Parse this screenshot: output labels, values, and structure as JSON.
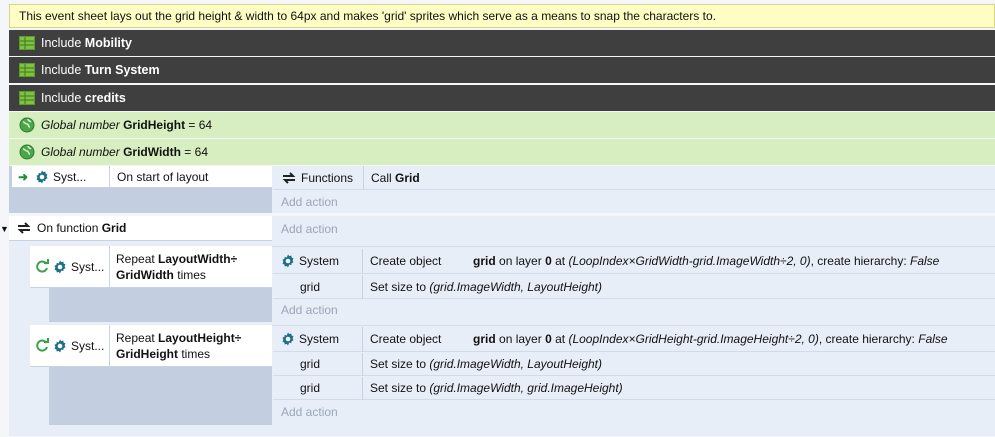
{
  "comment": "This event sheet lays out the grid height & width to 64px and makes 'grid' sprites which serve as a means to snap the characters to.",
  "includes": [
    {
      "prefix": "Include",
      "name": "Mobility"
    },
    {
      "prefix": "Include",
      "name": "Turn System"
    },
    {
      "prefix": "Include",
      "name": "credits"
    }
  ],
  "globals": [
    {
      "prefix": "Global number",
      "name": "GridHeight",
      "suffix": "= 64"
    },
    {
      "prefix": "Global number",
      "name": "GridWidth",
      "suffix": "= 64"
    }
  ],
  "event_start": {
    "object": "Syst...",
    "condition": "On start of layout",
    "action_object": "Functions",
    "action_prefix": "Call",
    "action_name": "Grid",
    "add_action": "Add action"
  },
  "function_event": {
    "prefix": "On function",
    "name": "Grid",
    "add_action": "Add action"
  },
  "sub1": {
    "object": "Syst...",
    "cond_prefix": "Repeat",
    "cond_bold1": "LayoutWidth÷",
    "cond_bold2": "GridWidth",
    "cond_suffix": "times",
    "actions": [
      {
        "object": "System",
        "label": "Create object",
        "obj": "grid",
        "mid": "on layer",
        "layer": "0",
        "at": "at",
        "expr": "(LoopIndex×GridWidth-grid.ImageWidth÷2, 0)",
        "tail": ", create hierarchy:",
        "val": "False"
      },
      {
        "object": "grid",
        "label": "Set size to",
        "expr": "(grid.ImageWidth, LayoutHeight)"
      }
    ],
    "add_action": "Add action"
  },
  "sub2": {
    "object": "Syst...",
    "cond_prefix": "Repeat",
    "cond_bold1": "LayoutHeight÷",
    "cond_bold2": "GridHeight",
    "cond_suffix": "times",
    "actions": [
      {
        "object": "System",
        "label": "Create object",
        "obj": "grid",
        "mid": "on layer",
        "layer": "0",
        "at": "at",
        "expr": "(LoopIndex×GridHeight-grid.ImageHeight÷2, 0)",
        "tail": ", create hierarchy:",
        "val": "False"
      },
      {
        "object": "grid",
        "label": "Set size to",
        "expr": "(grid.ImageWidth, LayoutHeight)"
      },
      {
        "object": "grid",
        "label": "Set size to",
        "expr": "(grid.ImageWidth, grid.ImageHeight)"
      }
    ],
    "add_action": "Add action"
  },
  "colors": {
    "include_bg": "#3f3f3f",
    "global_bg": "#d7eec0",
    "comment_bg": "#fdfdc4",
    "event_bg": "#e8eef8"
  }
}
